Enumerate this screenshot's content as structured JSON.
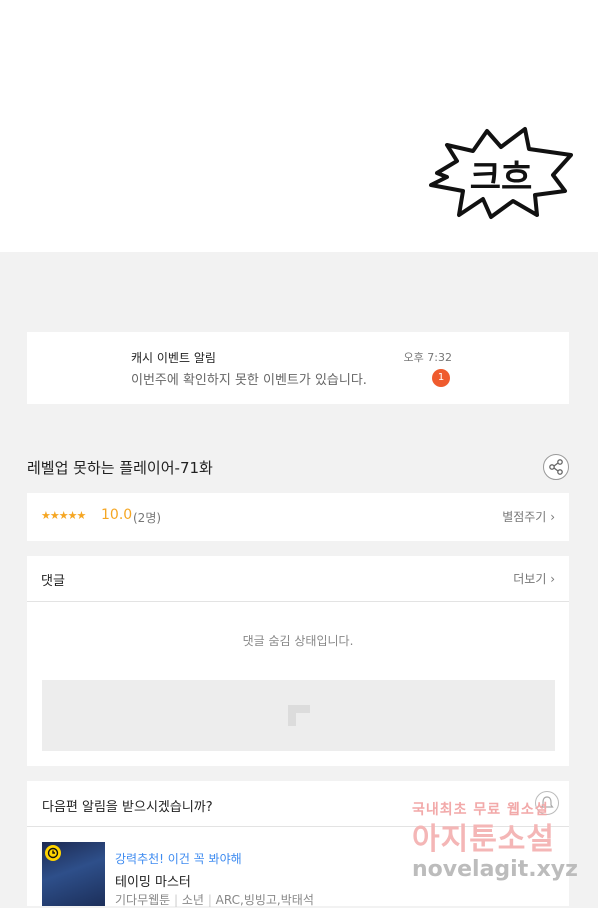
{
  "comic": {
    "sfx_text": "크흐"
  },
  "notice": {
    "title": "캐시 이벤트 알림",
    "body": "이번주에 확인하지 못한 이벤트가 있습니다.",
    "time": "오후 7:32",
    "badge": "1"
  },
  "episode": {
    "title": "레벨업 못하는 플레이어-71화",
    "share_icon": "share-icon"
  },
  "rating": {
    "stars": "★★★★★",
    "score": "10.0",
    "count": "(2명)",
    "rate_link": "별점주기"
  },
  "comments": {
    "title": "댓글",
    "more": "더보기",
    "hidden_message": "댓글 숨김 상태입니다."
  },
  "next_alert": {
    "title": "다음편 알림을 받으시겠습니까?",
    "recommend_label": "강력추천! 이건 꼭 봐야해",
    "recommend_title": "테이밍 마스터",
    "meta": [
      "기다무웹툰",
      "소년",
      "ARC,빙빙고,박태석"
    ]
  },
  "watermark": {
    "line1": "국내최초 무료 웹소설",
    "line2": "아지툰소설",
    "line3": "novelagit.xyz"
  },
  "colors": {
    "accent_orange": "#f5a623",
    "badge": "#ef5b2e",
    "link_blue": "#3e8bf0"
  }
}
